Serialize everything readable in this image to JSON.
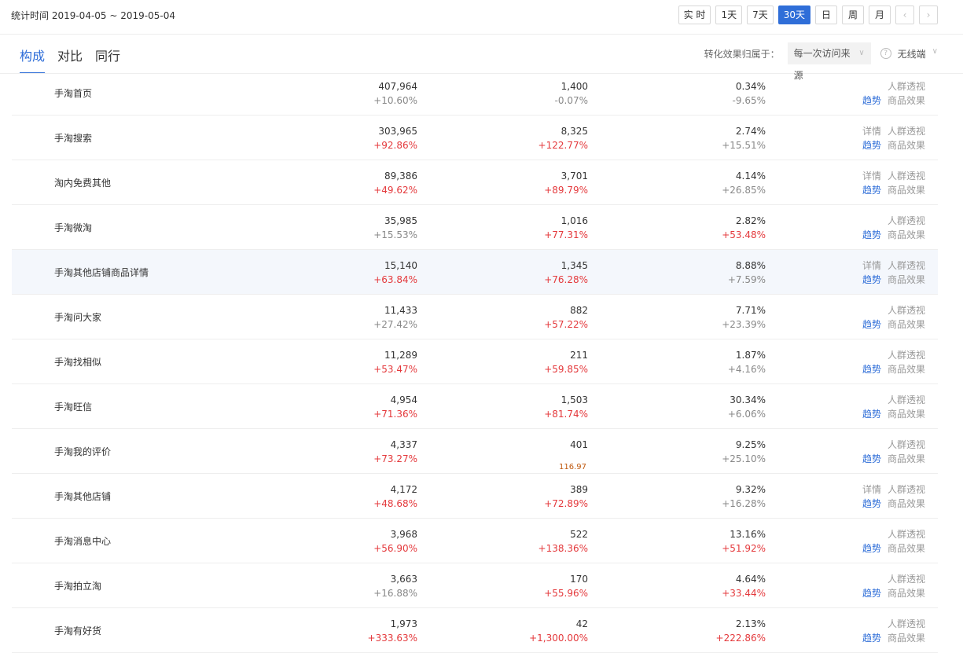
{
  "header": {
    "stat_time": "统计时间 2019-04-05 ~ 2019-05-04",
    "period_buttons": [
      {
        "label": "实 时",
        "active": false
      },
      {
        "label": "1天",
        "active": false
      },
      {
        "label": "7天",
        "active": false
      },
      {
        "label": "30天",
        "active": true
      },
      {
        "label": "日",
        "active": false
      },
      {
        "label": "周",
        "active": false
      },
      {
        "label": "月",
        "active": false
      }
    ],
    "prev": "‹",
    "next": "›"
  },
  "tabs": [
    "构成",
    "对比",
    "同行"
  ],
  "filter": {
    "label": "转化效果归属于：",
    "source_value": "每一次访问来源",
    "device_value": "无线端",
    "chevron": "∨",
    "help": "?"
  },
  "actions": {
    "detail": "详情",
    "crowd": "人群透视",
    "trend": "趋势",
    "product": "商品效果"
  },
  "rows": [
    {
      "name": "手淘首页",
      "c1": "407,964",
      "c1c": "+10.60%",
      "c1r": false,
      "c2": "1,400",
      "c2c": "-0.07%",
      "c2r": false,
      "c3": "0.34%",
      "c3c": "-9.65%",
      "c3r": false,
      "detail": false
    },
    {
      "name": "手淘搜索",
      "c1": "303,965",
      "c1c": "+92.86%",
      "c1r": true,
      "c2": "8,325",
      "c2c": "+122.77%",
      "c2r": true,
      "c3": "2.74%",
      "c3c": "+15.51%",
      "c3r": false,
      "detail": true
    },
    {
      "name": "淘内免费其他",
      "c1": "89,386",
      "c1c": "+49.62%",
      "c1r": true,
      "c2": "3,701",
      "c2c": "+89.79%",
      "c2r": true,
      "c3": "4.14%",
      "c3c": "+26.85%",
      "c3r": false,
      "detail": true
    },
    {
      "name": "手淘微淘",
      "c1": "35,985",
      "c1c": "+15.53%",
      "c1r": false,
      "c2": "1,016",
      "c2c": "+77.31%",
      "c2r": true,
      "c3": "2.82%",
      "c3c": "+53.48%",
      "c3r": true,
      "detail": false
    },
    {
      "name": "手淘其他店铺商品详情",
      "c1": "15,140",
      "c1c": "+63.84%",
      "c1r": true,
      "c2": "1,345",
      "c2c": "+76.28%",
      "c2r": true,
      "c3": "8.88%",
      "c3c": "+7.59%",
      "c3r": false,
      "detail": true,
      "highlight": true
    },
    {
      "name": "手淘问大家",
      "c1": "11,433",
      "c1c": "+27.42%",
      "c1r": false,
      "c2": "882",
      "c2c": "+57.22%",
      "c2r": true,
      "c3": "7.71%",
      "c3c": "+23.39%",
      "c3r": false,
      "detail": false
    },
    {
      "name": "手淘找相似",
      "c1": "11,289",
      "c1c": "+53.47%",
      "c1r": true,
      "c2": "211",
      "c2c": "+59.85%",
      "c2r": true,
      "c3": "1.87%",
      "c3c": "+4.16%",
      "c3r": false,
      "detail": false
    },
    {
      "name": "手淘旺信",
      "c1": "4,954",
      "c1c": "+71.36%",
      "c1r": true,
      "c2": "1,503",
      "c2c": "+81.74%",
      "c2r": true,
      "c3": "30.34%",
      "c3c": "+6.06%",
      "c3r": false,
      "detail": false
    },
    {
      "name": "手淘我的评价",
      "c1": "4,337",
      "c1c": "+73.27%",
      "c1r": true,
      "c2": "401",
      "c2c": "",
      "c2r": false,
      "c3": "9.25%",
      "c3c": "+25.10%",
      "c3r": false,
      "detail": false,
      "annotation": "116.97"
    },
    {
      "name": "手淘其他店铺",
      "c1": "4,172",
      "c1c": "+48.68%",
      "c1r": true,
      "c2": "389",
      "c2c": "+72.89%",
      "c2r": true,
      "c3": "9.32%",
      "c3c": "+16.28%",
      "c3r": false,
      "detail": true
    },
    {
      "name": "手淘消息中心",
      "c1": "3,968",
      "c1c": "+56.90%",
      "c1r": true,
      "c2": "522",
      "c2c": "+138.36%",
      "c2r": true,
      "c3": "13.16%",
      "c3c": "+51.92%",
      "c3r": true,
      "detail": false
    },
    {
      "name": "手淘拍立淘",
      "c1": "3,663",
      "c1c": "+16.88%",
      "c1r": false,
      "c2": "170",
      "c2c": "+55.96%",
      "c2r": true,
      "c3": "4.64%",
      "c3c": "+33.44%",
      "c3r": true,
      "detail": false
    },
    {
      "name": "手淘有好货",
      "c1": "1,973",
      "c1c": "+333.63%",
      "c1r": true,
      "c2": "42",
      "c2c": "+1,300.00%",
      "c2r": true,
      "c3": "2.13%",
      "c3c": "+222.86%",
      "c3r": true,
      "detail": false
    }
  ]
}
